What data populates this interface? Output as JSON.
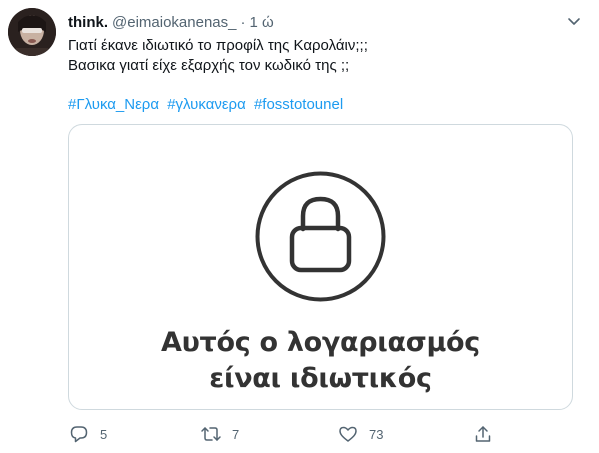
{
  "tweet": {
    "display_name": "think.",
    "handle": "@eimaiokanenas_",
    "separator": "·",
    "time": "1 ώ",
    "text_lines": [
      "Γιατί έκανε ιδιωτικό το προφίλ της Καρολάιν;;;",
      "Βασικα γιατί είχε εξαρχής τον κωδικό της ;;"
    ],
    "hashtags": [
      "#Γλυκα_Νερα",
      "#γλυκανερα",
      "#fosstotounel"
    ]
  },
  "media": {
    "private_text_lines": [
      "Αυτός ο λογαριασμός",
      "είναι ιδιωτικός"
    ],
    "icon": "lock-icon"
  },
  "actions": {
    "replies": "5",
    "retweets": "7",
    "likes": "73"
  },
  "colors": {
    "link": "#1d9bf0",
    "secondary_text": "#536471",
    "border": "#cfd9de"
  }
}
